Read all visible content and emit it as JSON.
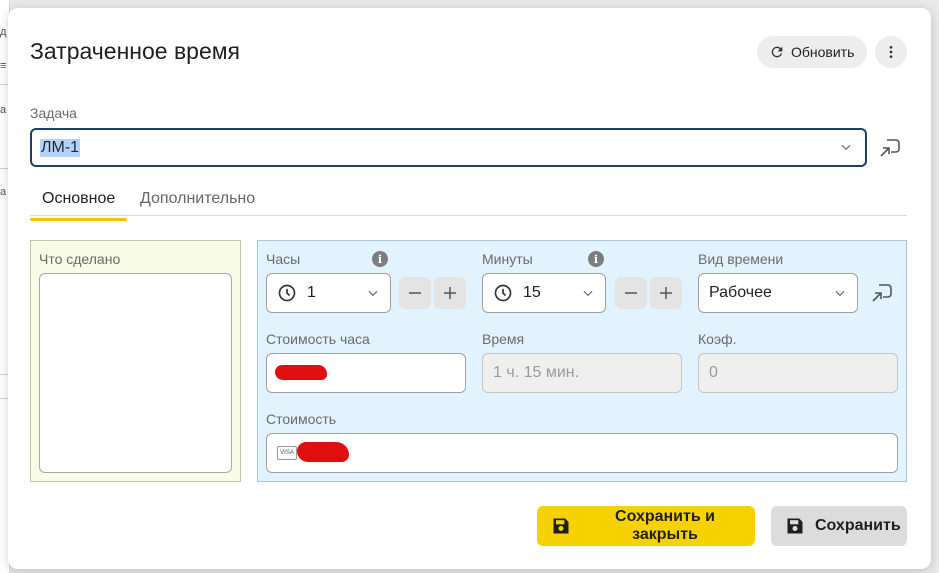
{
  "dialog": {
    "title": "Затраченное время",
    "refresh_label": "Обновить"
  },
  "task": {
    "label": "Задача",
    "value": "ЛМ-1"
  },
  "tabs": [
    {
      "label": "Основное",
      "active": true
    },
    {
      "label": "Дополнительно",
      "active": false
    }
  ],
  "notes": {
    "label": "Что сделано",
    "value": ""
  },
  "hours": {
    "label": "Часы",
    "value": "1"
  },
  "minutes": {
    "label": "Минуты",
    "value": "15"
  },
  "time_type": {
    "label": "Вид времени",
    "value": "Рабочее"
  },
  "hour_cost": {
    "label": "Стоимость часа"
  },
  "time": {
    "label": "Время",
    "value": "1 ч. 15 мин."
  },
  "coef": {
    "label": "Коэф.",
    "value": "0"
  },
  "cost": {
    "label": "Стоимость",
    "card_badge": "VISA"
  },
  "buttons": {
    "save_close": "Сохранить и закрыть",
    "save": "Сохранить"
  },
  "colors": {
    "accent": "#f6d300",
    "focus_border": "#1e3f66",
    "left_panel_bg": "#f8fbe6",
    "right_panel_bg": "#e2f3fd"
  },
  "icons": [
    "refresh-icon",
    "more-vert-icon",
    "chevron-down-icon",
    "open-link-icon",
    "clock-icon",
    "info-icon",
    "minus-icon",
    "plus-icon",
    "save-icon"
  ]
}
